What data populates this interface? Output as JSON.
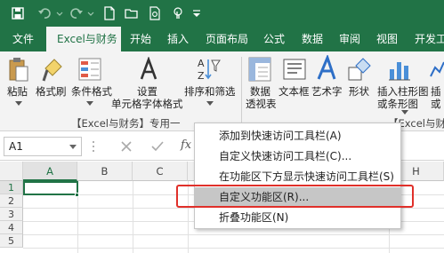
{
  "colors": {
    "accent": "#217346",
    "highlight": "#e0302a"
  },
  "quick_access": {
    "icons": [
      "save-icon",
      "undo-icon",
      "redo-icon",
      "new-file-icon",
      "open-folder-icon",
      "print-preview-icon",
      "touch-mode-icon",
      "customize-qat-icon"
    ]
  },
  "tabs": [
    {
      "label": "文件"
    },
    {
      "label": "Excel与财务"
    },
    {
      "label": "开始"
    },
    {
      "label": "插入"
    },
    {
      "label": "页面布局"
    },
    {
      "label": "公式"
    },
    {
      "label": "数据"
    },
    {
      "label": "审阅"
    },
    {
      "label": "视图"
    },
    {
      "label": "开发工"
    }
  ],
  "ribbon": {
    "buttons": [
      {
        "label": "粘贴",
        "icon": "paste-icon"
      },
      {
        "label": "格式刷",
        "icon": "format-painter-icon"
      },
      {
        "label": "条件格式",
        "icon": "conditional-format-icon"
      },
      {
        "label": "设置",
        "label2": "单元格字体格式",
        "icon": "font-format-icon"
      },
      {
        "label": "排序和筛选",
        "icon": "sort-filter-icon"
      },
      {
        "label": "数据",
        "label2": "透视表",
        "icon": "pivot-table-icon"
      },
      {
        "label": "文本框",
        "icon": "textbox-icon"
      },
      {
        "label": "艺术字",
        "icon": "wordart-icon"
      },
      {
        "label": "形状",
        "icon": "shapes-icon"
      },
      {
        "label": "插入柱形图",
        "label2": "或条形图",
        "icon": "bar-chart-icon"
      },
      {
        "label": "插",
        "label2": "或",
        "icon": "line-chart-icon"
      }
    ],
    "group_labels": [
      "【Excel与财务】专用一",
      "【Excel与财务"
    ]
  },
  "formula_bar": {
    "name_box": "A1",
    "fx": "fx"
  },
  "grid": {
    "columns": [
      "A",
      "B",
      "C",
      "H"
    ],
    "rows": [
      "1",
      "2",
      "3",
      "4",
      "5"
    ]
  },
  "context_menu": {
    "items": [
      {
        "label": "添加到快速访问工具栏(A)"
      },
      {
        "label": "自定义快速访问工具栏(C)..."
      },
      {
        "label": "在功能区下方显示快速访问工具栏(S)"
      },
      {
        "label": "自定义功能区(R)..."
      },
      {
        "label": "折叠功能区(N)"
      }
    ]
  }
}
